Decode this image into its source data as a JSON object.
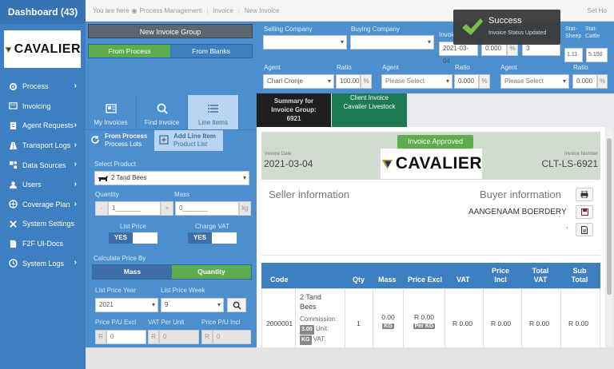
{
  "sidebar": {
    "title": "Dashboard (43)",
    "logo": "CAVALIER",
    "items": [
      {
        "label": "Process",
        "icon": "process-icon",
        "chevron": true
      },
      {
        "label": "Invoicing",
        "icon": "invoice-icon",
        "chevron": false
      },
      {
        "label": "Agent Requests",
        "icon": "clipboard-icon",
        "chevron": true
      },
      {
        "label": "Transport Logs",
        "icon": "road-icon",
        "chevron": true
      },
      {
        "label": "Data Sources",
        "icon": "data-icon",
        "chevron": true
      },
      {
        "label": "Users",
        "icon": "user-icon",
        "chevron": true
      },
      {
        "label": "Coverage Plan",
        "icon": "coverage-icon",
        "chevron": true
      },
      {
        "label": "System Settings",
        "icon": "settings-icon",
        "chevron": false
      },
      {
        "label": "F2F UI-Docs",
        "icon": "doc-icon",
        "chevron": false
      },
      {
        "label": "System Logs",
        "icon": "log-icon",
        "chevron": true
      }
    ]
  },
  "breadcrumb": {
    "prefix": "You are here",
    "items": [
      "Process Management",
      "Invoice",
      "New Invoice"
    ]
  },
  "top_right": "Set Ho",
  "group": {
    "new_group": "New Invoice Group",
    "from_process": "From Process",
    "from_blanks": "From Blanks"
  },
  "form": {
    "selling_company": "Selling Company",
    "buying_company": "Buying Company",
    "invoice_label": "Invoice",
    "date": "2021-03-04",
    "d_pct": "0.000",
    "d_num": "3",
    "stat_sheep": "Stat-Sheep",
    "stat_cattle": "Stat-Cattle",
    "stat_sheep_val": "1.11",
    "stat_cattle_val": "5.150",
    "agent1_label": "Agent",
    "agent1_val": "Charl Cronje",
    "ratio1_label": "Ratio",
    "ratio1_val": "100.00",
    "agent2_label": "Agent",
    "agent2_val": "Please Select",
    "ratio2_label": "Ratio",
    "ratio2_val": "0.000",
    "agent3_label": "Agent",
    "agent3_val": "Please Select",
    "ratio3_label": "Ratio",
    "ratio3_val": "0.000",
    "pct": "%"
  },
  "tabs": {
    "my": "My Invoices",
    "find": "Find Invoice",
    "line": "Line Items"
  },
  "subtabs": {
    "from_process": "From Process",
    "from_process_sub": "Process Lots",
    "add_line": "Add Line Item",
    "add_line_sub": "Product List"
  },
  "product": {
    "select_label": "Select Product",
    "value": "2 Tand Bees",
    "quantity_label": "Quantity",
    "quantity_val": "1_______",
    "mass_label": "Mass",
    "mass_val": "0_______",
    "kg": "kg",
    "minus": "-",
    "plus": "+",
    "list_price_label": "List Price",
    "charge_vat_label": "Charge VAT",
    "yes1": "YES",
    "yes2": "YES",
    "calc_label": "Calculate Price By",
    "mass_btn": "Mass",
    "qty_btn": "Quantity",
    "year_label": "List Price Year",
    "year_val": "2021",
    "week_label": "List Price Week",
    "week_val": "9",
    "ppu_excl": "Price P/U Excl",
    "vat_unit": "VAT Per Unit",
    "ppu_incl": "Price P/U Incl",
    "r": "R",
    "zero": "0"
  },
  "summary": {
    "line1": "Summary for",
    "line2": "Invoice Group:",
    "line3": "6921"
  },
  "client": {
    "line1": "Client Invoice",
    "line2": "Cavalier Livestock"
  },
  "invoice": {
    "status": "Invoice Approved",
    "date_label": "Invoice Date",
    "date": "2021-03-04",
    "num_label": "Invoice Number",
    "num": "CLT-LS-6921",
    "logo": "CAVALIER",
    "seller": "Seller information",
    "buyer": "Buyer information",
    "buyer_name": "AANGENAAM BOERDERY",
    "buyer_extra": ","
  },
  "table": {
    "headers": [
      "Code",
      "Qty",
      "Mass",
      "Price Excl",
      "VAT",
      "Price Incl",
      "Total VAT",
      "Sub Total"
    ],
    "row": {
      "code": "2000001",
      "desc": "2 Tand Bees",
      "commission_label": "Commission:",
      "commission": "3.00",
      "unit_label": "Unit:",
      "unit": "KG",
      "vat_label": "VAT:",
      "qty": "1",
      "mass": "0.00",
      "mass_unit": "KG",
      "price": "R 0.00",
      "price_unit": "Per KG",
      "vat": "R 0.00",
      "incl": "R 0.00",
      "total_vat": "R 0.00",
      "sub": "R 0.00"
    }
  },
  "toast": {
    "title": "Success",
    "message": "Invoice Status Updated"
  },
  "colors": {
    "sidebar": "#3e7fc1",
    "panel": "#4b8fcf",
    "green": "#5fac4f",
    "dark": "#1f1f1f",
    "teal": "#1e7a52"
  }
}
